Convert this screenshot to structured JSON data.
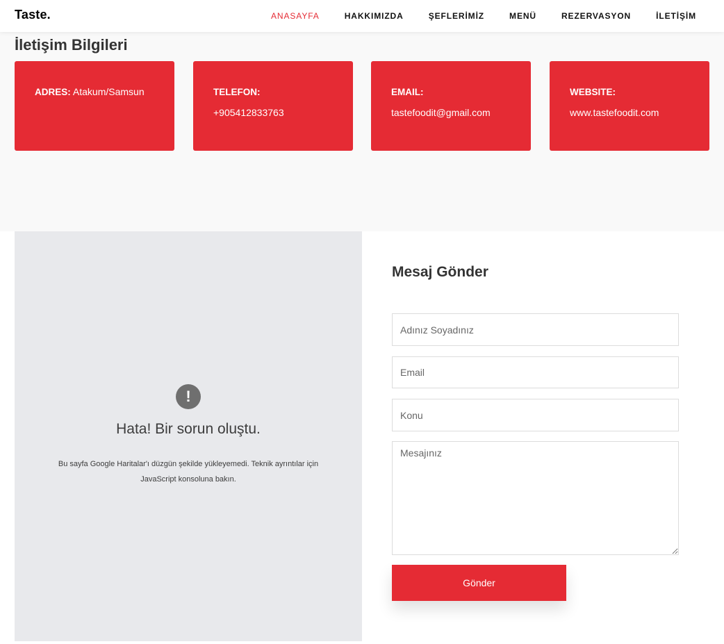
{
  "brand": "Taste.",
  "nav": {
    "items": [
      "ANASAYFA",
      "HAKKIMIZDA",
      "ŞEFLERİMİZ",
      "MENÜ",
      "REZERVASYON",
      "İLETİŞİM"
    ],
    "active": "ANASAYFA",
    "active_color": "#e52b34"
  },
  "info": {
    "title": "İletişim Bilgileri",
    "cards": [
      {
        "label": "ADRES:",
        "value": "Atakum/Samsun"
      },
      {
        "label": "TELEFON:",
        "value": "+905412833763"
      },
      {
        "label": "EMAIL:",
        "value": "tastefoodit@gmail.com"
      },
      {
        "label": "WEBSITE:",
        "value": "www.tastefoodit.com"
      }
    ],
    "card_color": "#e52b34"
  },
  "map": {
    "icon": "exclamation-icon",
    "error_title": "Hata! Bir sorun oluştu.",
    "error_text": "Bu sayfa Google Haritalar'ı düzgün şekilde yükleyemedi. Teknik ayrıntılar için JavaScript konsoluna bakın."
  },
  "form": {
    "title": "Mesaj Gönder",
    "name_placeholder": "Adınız Soyadınız",
    "email_placeholder": "Email",
    "subject_placeholder": "Konu",
    "message_placeholder": "Mesajınız",
    "submit_label": "Gönder"
  }
}
